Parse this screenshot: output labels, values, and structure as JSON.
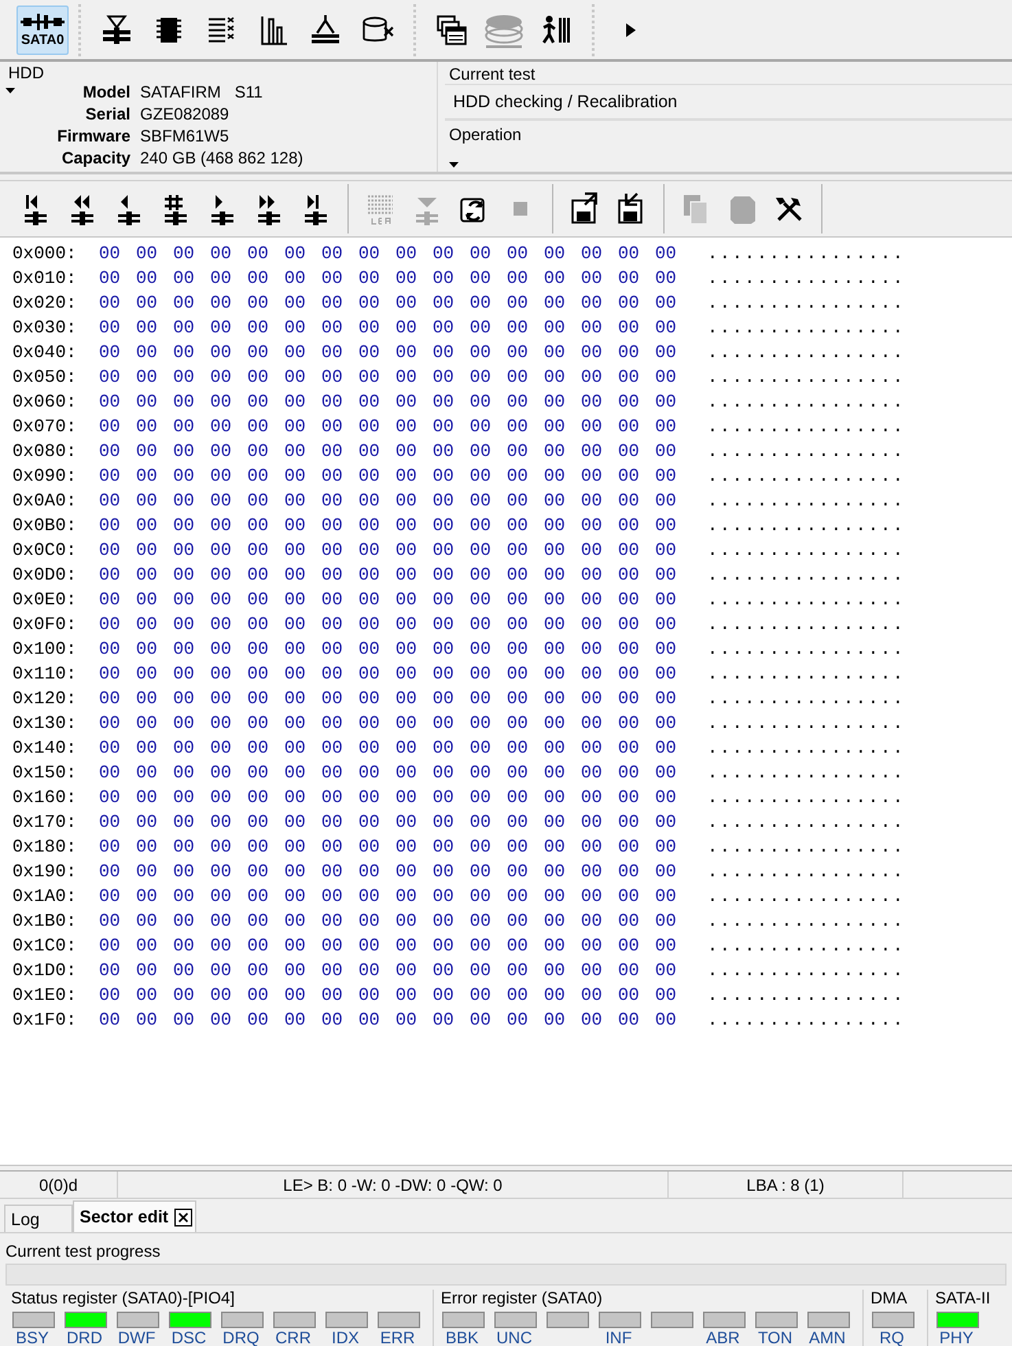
{
  "main_toolbar": [
    {
      "kind": "port",
      "label": "SATA0",
      "selected": true
    },
    {
      "kind": "hourglass-disk",
      "selected": false
    },
    {
      "kind": "chip",
      "selected": false
    },
    {
      "kind": "list",
      "selected": false
    },
    {
      "kind": "bar-chart",
      "selected": false
    },
    {
      "kind": "compass-disk",
      "selected": false
    },
    {
      "kind": "drive-cross",
      "selected": false
    },
    {
      "kind": "separator"
    },
    {
      "kind": "windows",
      "selected": false
    },
    {
      "kind": "disk-stack",
      "selected": false,
      "disabled": true
    },
    {
      "kind": "person-bars",
      "selected": false
    },
    {
      "kind": "separator"
    },
    {
      "kind": "play",
      "selected": false
    }
  ],
  "hdd": {
    "title": "HDD",
    "fields": [
      {
        "label": "Model",
        "value": "SATAFIRM   S11"
      },
      {
        "label": "Serial",
        "value": "GZE082089"
      },
      {
        "label": "Firmware",
        "value": "SBFM61W5"
      },
      {
        "label": "Capacity",
        "value": "240 GB (468 862 128)"
      }
    ]
  },
  "current_test": {
    "title": "Current test",
    "value": "HDD checking / Recalibration"
  },
  "operation": {
    "title": "Operation"
  },
  "sector_toolbar": [
    {
      "kind": "first",
      "disabled": false
    },
    {
      "kind": "rewind",
      "disabled": false
    },
    {
      "kind": "prev",
      "disabled": false
    },
    {
      "kind": "goto",
      "disabled": false
    },
    {
      "kind": "next",
      "disabled": false
    },
    {
      "kind": "forward",
      "disabled": false
    },
    {
      "kind": "last",
      "disabled": false
    },
    {
      "kind": "separator"
    },
    {
      "kind": "lba",
      "disabled": true
    },
    {
      "kind": "down",
      "disabled": true
    },
    {
      "kind": "refresh",
      "disabled": false
    },
    {
      "kind": "stop",
      "disabled": true
    },
    {
      "kind": "separator"
    },
    {
      "kind": "save",
      "disabled": false
    },
    {
      "kind": "load",
      "disabled": false
    },
    {
      "kind": "separator"
    },
    {
      "kind": "copy",
      "disabled": true
    },
    {
      "kind": "paste",
      "disabled": true
    },
    {
      "kind": "tools",
      "disabled": false
    },
    {
      "kind": "separator"
    }
  ],
  "hex_rows": [
    {
      "offset": "0x000:",
      "bytes": [
        "00",
        "00",
        "00",
        "00",
        "00",
        "00",
        "00",
        "00",
        "00",
        "00",
        "00",
        "00",
        "00",
        "00",
        "00",
        "00"
      ],
      "ascii": "................"
    },
    {
      "offset": "0x010:",
      "bytes": [
        "00",
        "00",
        "00",
        "00",
        "00",
        "00",
        "00",
        "00",
        "00",
        "00",
        "00",
        "00",
        "00",
        "00",
        "00",
        "00"
      ],
      "ascii": "................"
    },
    {
      "offset": "0x020:",
      "bytes": [
        "00",
        "00",
        "00",
        "00",
        "00",
        "00",
        "00",
        "00",
        "00",
        "00",
        "00",
        "00",
        "00",
        "00",
        "00",
        "00"
      ],
      "ascii": "................"
    },
    {
      "offset": "0x030:",
      "bytes": [
        "00",
        "00",
        "00",
        "00",
        "00",
        "00",
        "00",
        "00",
        "00",
        "00",
        "00",
        "00",
        "00",
        "00",
        "00",
        "00"
      ],
      "ascii": "................"
    },
    {
      "offset": "0x040:",
      "bytes": [
        "00",
        "00",
        "00",
        "00",
        "00",
        "00",
        "00",
        "00",
        "00",
        "00",
        "00",
        "00",
        "00",
        "00",
        "00",
        "00"
      ],
      "ascii": "................"
    },
    {
      "offset": "0x050:",
      "bytes": [
        "00",
        "00",
        "00",
        "00",
        "00",
        "00",
        "00",
        "00",
        "00",
        "00",
        "00",
        "00",
        "00",
        "00",
        "00",
        "00"
      ],
      "ascii": "................"
    },
    {
      "offset": "0x060:",
      "bytes": [
        "00",
        "00",
        "00",
        "00",
        "00",
        "00",
        "00",
        "00",
        "00",
        "00",
        "00",
        "00",
        "00",
        "00",
        "00",
        "00"
      ],
      "ascii": "................"
    },
    {
      "offset": "0x070:",
      "bytes": [
        "00",
        "00",
        "00",
        "00",
        "00",
        "00",
        "00",
        "00",
        "00",
        "00",
        "00",
        "00",
        "00",
        "00",
        "00",
        "00"
      ],
      "ascii": "................"
    },
    {
      "offset": "0x080:",
      "bytes": [
        "00",
        "00",
        "00",
        "00",
        "00",
        "00",
        "00",
        "00",
        "00",
        "00",
        "00",
        "00",
        "00",
        "00",
        "00",
        "00"
      ],
      "ascii": "................"
    },
    {
      "offset": "0x090:",
      "bytes": [
        "00",
        "00",
        "00",
        "00",
        "00",
        "00",
        "00",
        "00",
        "00",
        "00",
        "00",
        "00",
        "00",
        "00",
        "00",
        "00"
      ],
      "ascii": "................"
    },
    {
      "offset": "0x0A0:",
      "bytes": [
        "00",
        "00",
        "00",
        "00",
        "00",
        "00",
        "00",
        "00",
        "00",
        "00",
        "00",
        "00",
        "00",
        "00",
        "00",
        "00"
      ],
      "ascii": "................"
    },
    {
      "offset": "0x0B0:",
      "bytes": [
        "00",
        "00",
        "00",
        "00",
        "00",
        "00",
        "00",
        "00",
        "00",
        "00",
        "00",
        "00",
        "00",
        "00",
        "00",
        "00"
      ],
      "ascii": "................"
    },
    {
      "offset": "0x0C0:",
      "bytes": [
        "00",
        "00",
        "00",
        "00",
        "00",
        "00",
        "00",
        "00",
        "00",
        "00",
        "00",
        "00",
        "00",
        "00",
        "00",
        "00"
      ],
      "ascii": "................"
    },
    {
      "offset": "0x0D0:",
      "bytes": [
        "00",
        "00",
        "00",
        "00",
        "00",
        "00",
        "00",
        "00",
        "00",
        "00",
        "00",
        "00",
        "00",
        "00",
        "00",
        "00"
      ],
      "ascii": "................"
    },
    {
      "offset": "0x0E0:",
      "bytes": [
        "00",
        "00",
        "00",
        "00",
        "00",
        "00",
        "00",
        "00",
        "00",
        "00",
        "00",
        "00",
        "00",
        "00",
        "00",
        "00"
      ],
      "ascii": "................"
    },
    {
      "offset": "0x0F0:",
      "bytes": [
        "00",
        "00",
        "00",
        "00",
        "00",
        "00",
        "00",
        "00",
        "00",
        "00",
        "00",
        "00",
        "00",
        "00",
        "00",
        "00"
      ],
      "ascii": "................"
    },
    {
      "offset": "0x100:",
      "bytes": [
        "00",
        "00",
        "00",
        "00",
        "00",
        "00",
        "00",
        "00",
        "00",
        "00",
        "00",
        "00",
        "00",
        "00",
        "00",
        "00"
      ],
      "ascii": "................"
    },
    {
      "offset": "0x110:",
      "bytes": [
        "00",
        "00",
        "00",
        "00",
        "00",
        "00",
        "00",
        "00",
        "00",
        "00",
        "00",
        "00",
        "00",
        "00",
        "00",
        "00"
      ],
      "ascii": "................"
    },
    {
      "offset": "0x120:",
      "bytes": [
        "00",
        "00",
        "00",
        "00",
        "00",
        "00",
        "00",
        "00",
        "00",
        "00",
        "00",
        "00",
        "00",
        "00",
        "00",
        "00"
      ],
      "ascii": "................"
    },
    {
      "offset": "0x130:",
      "bytes": [
        "00",
        "00",
        "00",
        "00",
        "00",
        "00",
        "00",
        "00",
        "00",
        "00",
        "00",
        "00",
        "00",
        "00",
        "00",
        "00"
      ],
      "ascii": "................"
    },
    {
      "offset": "0x140:",
      "bytes": [
        "00",
        "00",
        "00",
        "00",
        "00",
        "00",
        "00",
        "00",
        "00",
        "00",
        "00",
        "00",
        "00",
        "00",
        "00",
        "00"
      ],
      "ascii": "................"
    },
    {
      "offset": "0x150:",
      "bytes": [
        "00",
        "00",
        "00",
        "00",
        "00",
        "00",
        "00",
        "00",
        "00",
        "00",
        "00",
        "00",
        "00",
        "00",
        "00",
        "00"
      ],
      "ascii": "................"
    },
    {
      "offset": "0x160:",
      "bytes": [
        "00",
        "00",
        "00",
        "00",
        "00",
        "00",
        "00",
        "00",
        "00",
        "00",
        "00",
        "00",
        "00",
        "00",
        "00",
        "00"
      ],
      "ascii": "................"
    },
    {
      "offset": "0x170:",
      "bytes": [
        "00",
        "00",
        "00",
        "00",
        "00",
        "00",
        "00",
        "00",
        "00",
        "00",
        "00",
        "00",
        "00",
        "00",
        "00",
        "00"
      ],
      "ascii": "................"
    },
    {
      "offset": "0x180:",
      "bytes": [
        "00",
        "00",
        "00",
        "00",
        "00",
        "00",
        "00",
        "00",
        "00",
        "00",
        "00",
        "00",
        "00",
        "00",
        "00",
        "00"
      ],
      "ascii": "................"
    },
    {
      "offset": "0x190:",
      "bytes": [
        "00",
        "00",
        "00",
        "00",
        "00",
        "00",
        "00",
        "00",
        "00",
        "00",
        "00",
        "00",
        "00",
        "00",
        "00",
        "00"
      ],
      "ascii": "................"
    },
    {
      "offset": "0x1A0:",
      "bytes": [
        "00",
        "00",
        "00",
        "00",
        "00",
        "00",
        "00",
        "00",
        "00",
        "00",
        "00",
        "00",
        "00",
        "00",
        "00",
        "00"
      ],
      "ascii": "................"
    },
    {
      "offset": "0x1B0:",
      "bytes": [
        "00",
        "00",
        "00",
        "00",
        "00",
        "00",
        "00",
        "00",
        "00",
        "00",
        "00",
        "00",
        "00",
        "00",
        "00",
        "00"
      ],
      "ascii": "................"
    },
    {
      "offset": "0x1C0:",
      "bytes": [
        "00",
        "00",
        "00",
        "00",
        "00",
        "00",
        "00",
        "00",
        "00",
        "00",
        "00",
        "00",
        "00",
        "00",
        "00",
        "00"
      ],
      "ascii": "................"
    },
    {
      "offset": "0x1D0:",
      "bytes": [
        "00",
        "00",
        "00",
        "00",
        "00",
        "00",
        "00",
        "00",
        "00",
        "00",
        "00",
        "00",
        "00",
        "00",
        "00",
        "00"
      ],
      "ascii": "................"
    },
    {
      "offset": "0x1E0:",
      "bytes": [
        "00",
        "00",
        "00",
        "00",
        "00",
        "00",
        "00",
        "00",
        "00",
        "00",
        "00",
        "00",
        "00",
        "00",
        "00",
        "00"
      ],
      "ascii": "................"
    },
    {
      "offset": "0x1F0:",
      "bytes": [
        "00",
        "00",
        "00",
        "00",
        "00",
        "00",
        "00",
        "00",
        "00",
        "00",
        "00",
        "00",
        "00",
        "00",
        "00",
        "00"
      ],
      "ascii": "................"
    }
  ],
  "status_bar": [
    "0(0)d",
    "LE> B: 0 -W: 0 -DW: 0 -QW: 0",
    "LBA : 8 (1)"
  ],
  "tabs": [
    {
      "label": "Log",
      "selected": false,
      "closable": false
    },
    {
      "label": "Sector edit",
      "selected": true,
      "closable": true
    }
  ],
  "progress": {
    "label": "Current test progress",
    "level": 0
  },
  "registers": [
    {
      "title": "Status register (SATA0)-[PIO4]",
      "lights": [
        {
          "label": "BSY",
          "on": false
        },
        {
          "label": "DRD",
          "on": true
        },
        {
          "label": "DWF",
          "on": false
        },
        {
          "label": "DSC",
          "on": true
        },
        {
          "label": "DRQ",
          "on": false
        },
        {
          "label": "CRR",
          "on": false
        },
        {
          "label": "IDX",
          "on": false
        },
        {
          "label": "ERR",
          "on": false
        }
      ]
    },
    {
      "title": "Error register (SATA0)",
      "lights": [
        {
          "label": "BBK",
          "on": false
        },
        {
          "label": "UNC",
          "on": false
        },
        {
          "on": false
        },
        {
          "label": "INF",
          "on": false
        },
        {
          "on": false
        },
        {
          "label": "ABR",
          "on": false
        },
        {
          "label": "TON",
          "on": false
        },
        {
          "label": "AMN",
          "on": false
        }
      ]
    },
    {
      "title": "DMA",
      "lights": [
        {
          "label": "RQ",
          "on": false
        }
      ]
    },
    {
      "title": "SATA-II",
      "lights": [
        {
          "label": "PHY",
          "on": true
        }
      ]
    }
  ]
}
